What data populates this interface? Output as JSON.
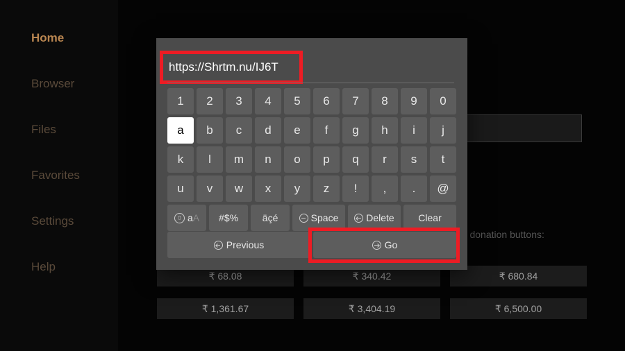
{
  "sidebar": {
    "items": [
      {
        "label": "Home",
        "active": true
      },
      {
        "label": "Browser"
      },
      {
        "label": "Files"
      },
      {
        "label": "Favorites"
      },
      {
        "label": "Settings"
      },
      {
        "label": "Help"
      }
    ]
  },
  "background": {
    "donation_text_1": "ase donation buttons:",
    "donation_text_2": ")",
    "donations_row1": [
      "₹ 68.08",
      "₹ 340.42",
      "₹ 680.84"
    ],
    "donations_row2": [
      "₹ 1,361.67",
      "₹ 3,404.19",
      "₹ 6,500.00"
    ]
  },
  "modal": {
    "url": "https://Shrtm.nu/IJ6T",
    "row_digits": [
      "1",
      "2",
      "3",
      "4",
      "5",
      "6",
      "7",
      "8",
      "9",
      "0"
    ],
    "row_a": [
      "a",
      "b",
      "c",
      "d",
      "e",
      "f",
      "g",
      "h",
      "i",
      "j"
    ],
    "row_k": [
      "k",
      "l",
      "m",
      "n",
      "o",
      "p",
      "q",
      "r",
      "s",
      "t"
    ],
    "row_u": [
      "u",
      "v",
      "w",
      "x",
      "y",
      "z",
      "!",
      ",",
      ".",
      "@"
    ],
    "selected_key": "a",
    "fn_shift": "aA",
    "fn_sym": "#$%",
    "fn_accent": "äçé",
    "fn_space": "Space",
    "fn_delete": "Delete",
    "fn_clear": "Clear",
    "btn_prev": "Previous",
    "btn_go": "Go"
  }
}
